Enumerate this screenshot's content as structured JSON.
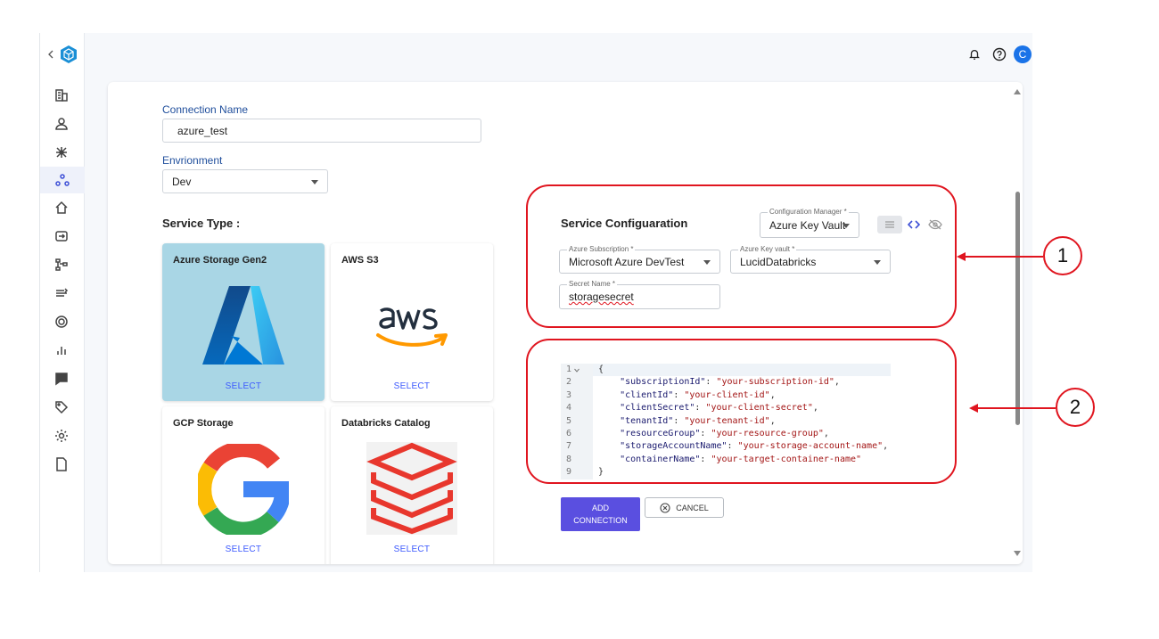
{
  "header": {
    "avatar_letter": "C"
  },
  "sidebar": {
    "items": [
      "building-icon",
      "user-icon",
      "network-icon",
      "connections-icon",
      "home-icon",
      "transform-icon",
      "pipeline-icon",
      "flow-icon",
      "target-icon",
      "bar-chart-icon",
      "message-icon",
      "tag-icon",
      "settings-icon",
      "document-icon"
    ]
  },
  "form": {
    "connection_name_label": "Connection Name",
    "connection_name_value": "azure_test",
    "environment_label": "Envrionment",
    "environment_value": "Dev",
    "service_type_label": "Service Type :"
  },
  "services": [
    {
      "title": "Azure Storage Gen2",
      "select": "SELECT",
      "logo": "azure-logo-icon"
    },
    {
      "title": "AWS S3",
      "select": "SELECT",
      "logo": "aws-logo-icon"
    },
    {
      "title": "GCP Storage",
      "select": "SELECT",
      "logo": "google-logo-icon"
    },
    {
      "title": "Databricks Catalog",
      "select": "SELECT",
      "logo": "databricks-logo-icon"
    }
  ],
  "config": {
    "title": "Service Configuaration",
    "config_manager_label": "Configuration Manager *",
    "config_manager_value": "Azure Key Vault",
    "subscription_label": "Azure Subscription *",
    "subscription_value": "Microsoft Azure DevTest",
    "key_vault_label": "Azure Key vault *",
    "key_vault_value": "LucidDatabricks",
    "secret_name_label": "Secret Name *",
    "secret_name_value": "storagesecret"
  },
  "code": {
    "lines": [
      {
        "n": "1",
        "parts": [
          [
            "p",
            "{"
          ]
        ]
      },
      {
        "n": "2",
        "parts": [
          [
            "p",
            "    "
          ],
          [
            "k",
            "\"subscriptionId\""
          ],
          [
            "p",
            ": "
          ],
          [
            "s",
            "\"your-subscription-id\""
          ],
          [
            "p",
            ","
          ]
        ]
      },
      {
        "n": "3",
        "parts": [
          [
            "p",
            "    "
          ],
          [
            "k",
            "\"clientId\""
          ],
          [
            "p",
            ": "
          ],
          [
            "s",
            "\"your-client-id\""
          ],
          [
            "p",
            ","
          ]
        ]
      },
      {
        "n": "4",
        "parts": [
          [
            "p",
            "    "
          ],
          [
            "k",
            "\"clientSecret\""
          ],
          [
            "p",
            ": "
          ],
          [
            "s",
            "\"your-client-secret\""
          ],
          [
            "p",
            ","
          ]
        ]
      },
      {
        "n": "5",
        "parts": [
          [
            "p",
            "    "
          ],
          [
            "k",
            "\"tenantId\""
          ],
          [
            "p",
            ": "
          ],
          [
            "s",
            "\"your-tenant-id\""
          ],
          [
            "p",
            ","
          ]
        ]
      },
      {
        "n": "6",
        "parts": [
          [
            "p",
            "    "
          ],
          [
            "k",
            "\"resourceGroup\""
          ],
          [
            "p",
            ": "
          ],
          [
            "s",
            "\"your-resource-group\""
          ],
          [
            "p",
            ","
          ]
        ]
      },
      {
        "n": "7",
        "parts": [
          [
            "p",
            "    "
          ],
          [
            "k",
            "\"storageAccountName\""
          ],
          [
            "p",
            ": "
          ],
          [
            "s",
            "\"your-storage-account-name\""
          ],
          [
            "p",
            ","
          ]
        ]
      },
      {
        "n": "8",
        "parts": [
          [
            "p",
            "    "
          ],
          [
            "k",
            "\"containerName\""
          ],
          [
            "p",
            ": "
          ],
          [
            "s",
            "\"your-target-container-name\""
          ]
        ]
      },
      {
        "n": "9",
        "parts": [
          [
            "p",
            "}"
          ]
        ]
      }
    ]
  },
  "actions": {
    "add_label": "ADD\nCONNECTION",
    "cancel_label": "CANCEL"
  },
  "annotations": {
    "callout_1": "1",
    "callout_2": "2"
  },
  "colors": {
    "accent": "#5a4fe0",
    "annotation": "#e0151f",
    "selected_tile": "#a9d6e5"
  }
}
